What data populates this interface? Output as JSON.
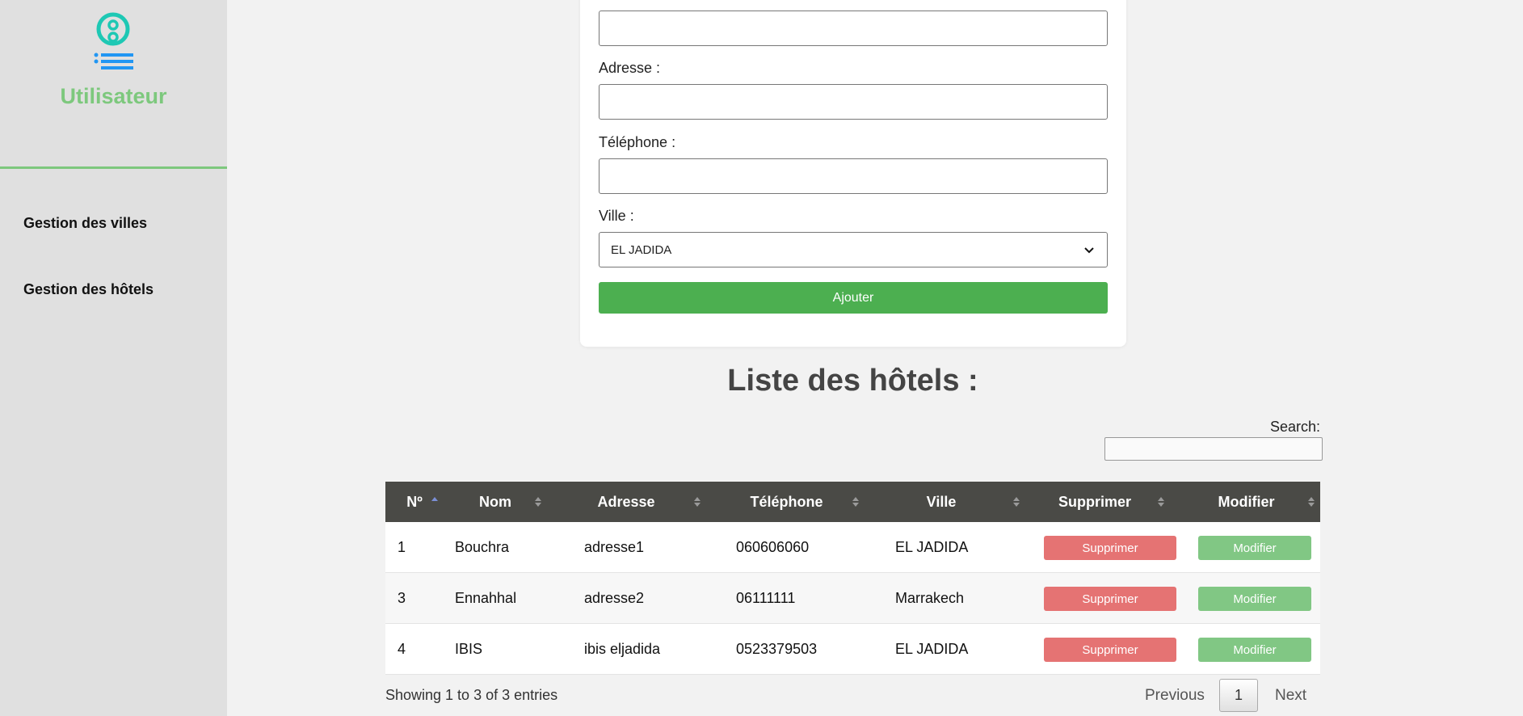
{
  "sidebar": {
    "title": "Utilisateur",
    "items": [
      {
        "label": "Gestion des villes"
      },
      {
        "label": "Gestion des hôtels"
      }
    ],
    "accent": "#7dc87d"
  },
  "form": {
    "name_value": "",
    "address_label": "Adresse :",
    "address_value": "",
    "phone_label": "Téléphone :",
    "phone_value": "",
    "city_label": "Ville :",
    "city_selected": "EL JADIDA",
    "submit_label": "Ajouter",
    "submit_color": "#4caf50"
  },
  "list": {
    "title": "Liste des hôtels :",
    "search_label": "Search:",
    "columns": [
      "Nº",
      "Nom",
      "Adresse",
      "Téléphone",
      "Ville",
      "Supprimer",
      "Modifier"
    ],
    "sorted_column": "Nº",
    "rows": [
      {
        "id": "1",
        "nom": "Bouchra",
        "adresse": "adresse1",
        "telephone": "060606060",
        "ville": "EL JADIDA",
        "delete_label": "Supprimer",
        "edit_label": "Modifier"
      },
      {
        "id": "3",
        "nom": "Ennahhal",
        "adresse": "adresse2",
        "telephone": "06111111",
        "ville": "Marrakech",
        "delete_label": "Supprimer",
        "edit_label": "Modifier"
      },
      {
        "id": "4",
        "nom": "IBIS",
        "adresse": "ibis eljadida",
        "telephone": "0523379503",
        "ville": "EL JADIDA",
        "delete_label": "Supprimer",
        "edit_label": "Modifier"
      }
    ],
    "info": "Showing 1 to 3 of 3 entries",
    "pagination": {
      "previous": "Previous",
      "current_page": "1",
      "next": "Next"
    },
    "delete_color": "#e57373",
    "edit_color": "#81c784"
  }
}
